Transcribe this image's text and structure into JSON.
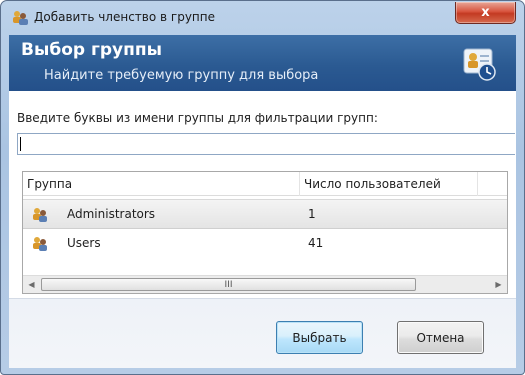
{
  "window": {
    "title": "Добавить членство в группе",
    "close_symbol": "x",
    "icon": "users-group-icon"
  },
  "header": {
    "title": "Выбор группы",
    "subtitle": "Найдите требуемую группу для выбора",
    "icon": "group-clock-icon"
  },
  "filter": {
    "label": "Введите буквы из имени группы для фильтрации групп:",
    "value": ""
  },
  "table": {
    "columns": [
      "Группа",
      "Число пользователей"
    ],
    "rows": [
      {
        "name": "Administrators",
        "count": "1",
        "icon": "group-icon",
        "selected": true
      },
      {
        "name": "Users",
        "count": "41",
        "icon": "group-icon",
        "selected": false
      }
    ],
    "scrollbar_grip": "III"
  },
  "buttons": {
    "ok": "Выбрать",
    "cancel": "Отмена"
  },
  "colors": {
    "header_bg": "#2b5a92",
    "close_red": "#c33a22",
    "selection_gray": "#e4e4e4"
  }
}
